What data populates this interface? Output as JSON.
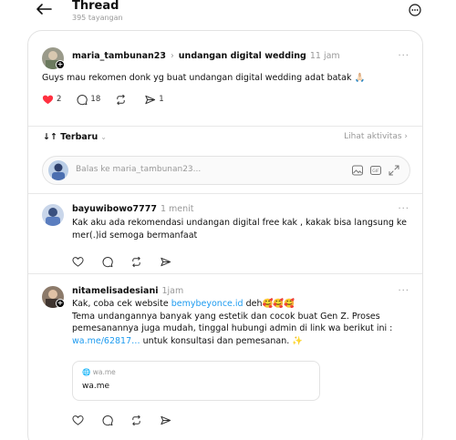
{
  "header": {
    "title": "Thread",
    "views": "395 tayangan"
  },
  "original_post": {
    "username": "maria_tambunan23",
    "separator": "›",
    "topic": "undangan digital wedding",
    "time": "11 jam",
    "text": "Guys mau rekomen donk yg buat undangan digital wedding adat batak",
    "emoji": "🙏🏻",
    "likes": "2",
    "replies": "18",
    "shares": "1"
  },
  "sort": {
    "label": "Terbaru",
    "chevron": "⌄",
    "activity": "Lihat aktivitas ›"
  },
  "reply_box": {
    "placeholder": "Balas ke maria_tambunan23...",
    "gif_label": "GIF"
  },
  "reply1": {
    "username": "bayuwibowo7777",
    "time": "1 menit",
    "text": "Kak aku ada rekomendasi undangan digital free kak , kakak bisa langsung ke mer(.)id semoga bermanfaat"
  },
  "reply2": {
    "username": "nitamelisadesiani",
    "time": "1jam",
    "text_a": "Kak, coba cek website ",
    "link1": "bemybeyonce.id",
    "text_b": " deh🥰🥰🥰",
    "text_c": "Tema undangannya banyak yang estetik dan cocok buat Gen Z. Proses pemesanannya juga mudah, tinggal hubungi admin di link wa berikut ini : ",
    "link2": "wa.me/62817…",
    "text_d": " untuk konsultasi dan pemesanan. ✨",
    "card_domain": "🌐 wa.me",
    "card_title": "wa.me"
  },
  "more_label": "···",
  "colors": {
    "like": "#ff3040",
    "link": "#1d9bf0",
    "muted": "#999999"
  }
}
